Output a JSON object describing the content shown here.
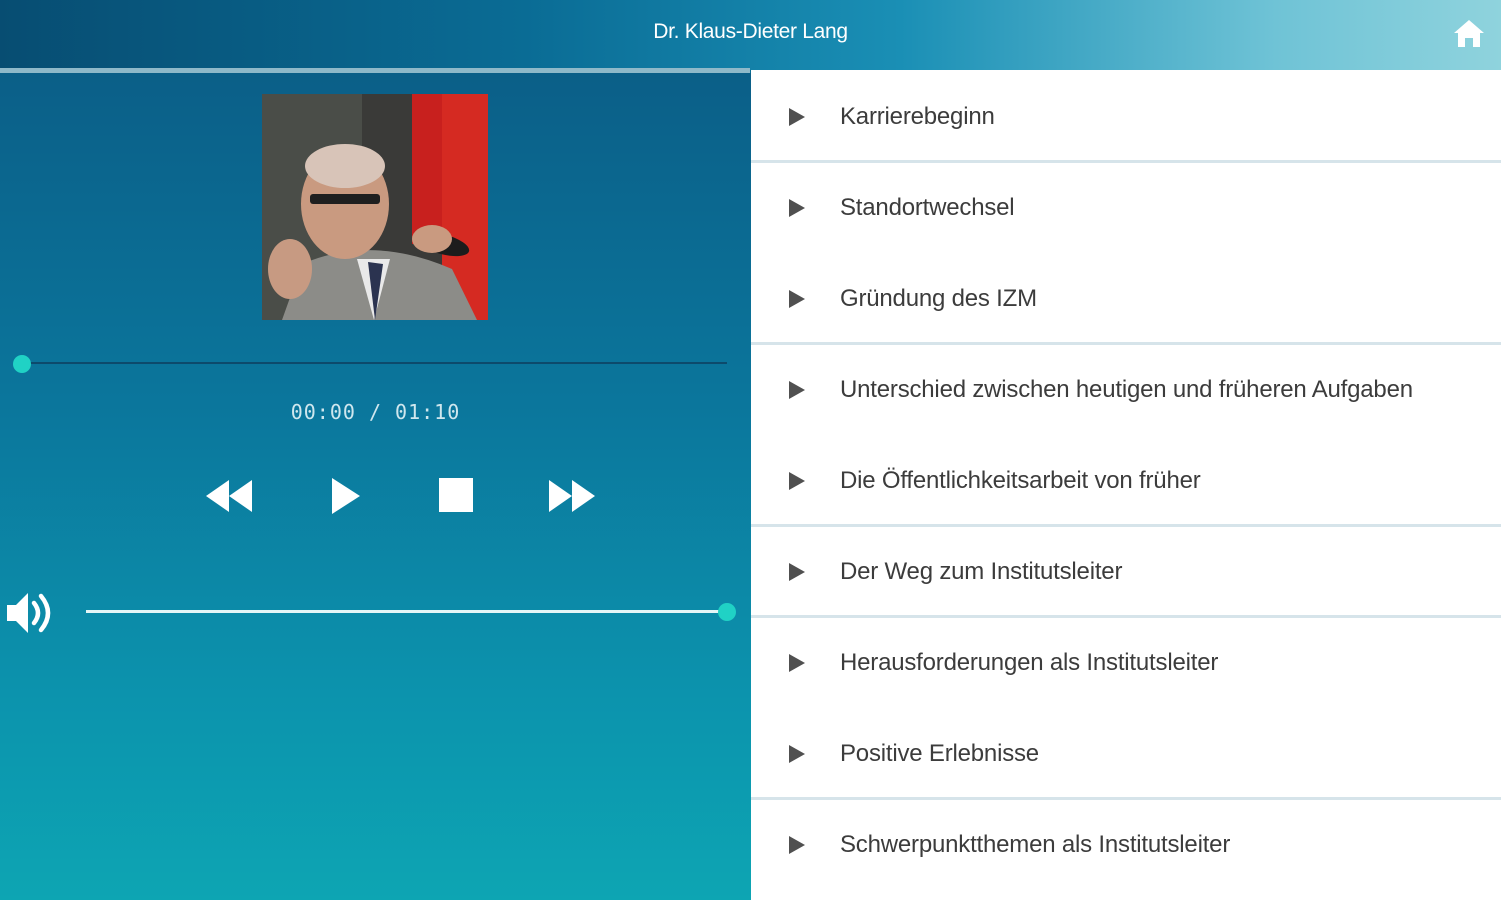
{
  "app": {
    "title": "Dr. Klaus-Dieter Lang",
    "home_icon": "home-icon"
  },
  "player": {
    "portrait_icon": "speaker-portrait",
    "progress": 0,
    "time_display": "00:00 / 01:10",
    "controls": [
      {
        "name": "rewind-button",
        "icon": "rewind-icon"
      },
      {
        "name": "play-button",
        "icon": "play-icon"
      },
      {
        "name": "stop-button",
        "icon": "stop-icon"
      },
      {
        "name": "fast-forward-button",
        "icon": "fast-forward-icon"
      }
    ],
    "volume_icon": "volume-icon",
    "volume": 1.0,
    "accent_color": "#20d2c5"
  },
  "chapters": [
    {
      "label": "Karrierebeginn"
    },
    {
      "label": "Standortwechsel"
    },
    {
      "label": "Gründung des IZM"
    },
    {
      "label": "Unterschied zwischen heutigen und früheren Aufgaben"
    },
    {
      "label": "Die Öffentlichkeitsarbeit von früher"
    },
    {
      "label": "Der Weg zum Institutsleiter"
    },
    {
      "label": "Herausforderungen als Institutsleiter"
    },
    {
      "label": "Positive Erlebnisse"
    },
    {
      "label": "Schwerpunktthemen als Institutsleiter"
    }
  ]
}
